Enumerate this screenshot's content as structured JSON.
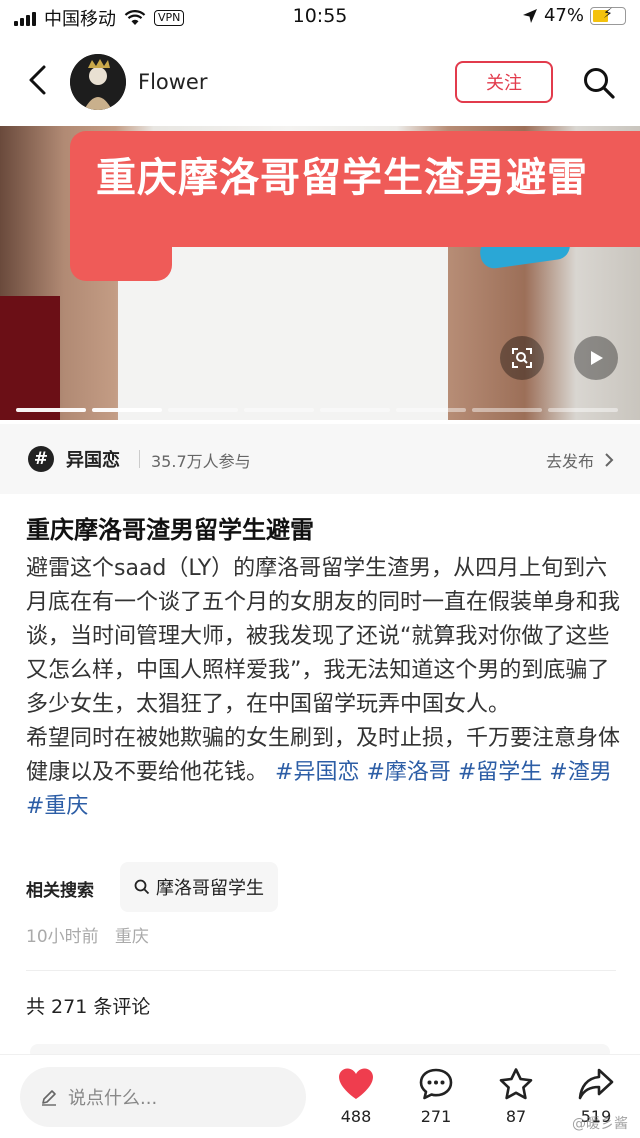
{
  "status_bar": {
    "carrier": "中国移动",
    "vpn": "VPN",
    "time": "10:55",
    "battery": "47%"
  },
  "header": {
    "author": "Flower",
    "follow_label": "关注"
  },
  "media": {
    "caption": "重庆摩洛哥留学生渣男避雷",
    "page_count": 8,
    "current_page": 1
  },
  "topic": {
    "name": "异国恋",
    "participants": "35.7万人参与",
    "action": "去发布"
  },
  "post": {
    "title": "重庆摩洛哥渣男留学生避雷",
    "body": "避雷这个saad（LY）的摩洛哥留学生渣男，从四月上旬到六月底在有一个谈了五个月的女朋友的同时一直在假装单身和我谈，当时间管理大师，被我发现了还说“就算我对你做了这些又怎么样，中国人照样爱我”，我无法知道这个男的到底骗了多少女生，太猖狂了，在中国留学玩弄中国女人。",
    "body2": "希望同时在被她欺骗的女生刷到，及时止损，千万要注意身体健康以及不要给他花钱。",
    "tags": "#异国恋 #摩洛哥 #留学生 #渣男#重庆",
    "related_label": "相关搜索",
    "related_query": "摩洛哥留学生",
    "time": "10小时前",
    "location": "重庆"
  },
  "comments": {
    "count_label": "共 271 条评论"
  },
  "bottom": {
    "input_placeholder": "说点什么...",
    "likes": "488",
    "comments": "271",
    "favorites": "87",
    "shares": "519",
    "watermark": "@暖彡酱"
  },
  "colors": {
    "accent": "#e23b4c",
    "caption_bg": "#ef5b58",
    "tag": "#2d5ea6"
  }
}
